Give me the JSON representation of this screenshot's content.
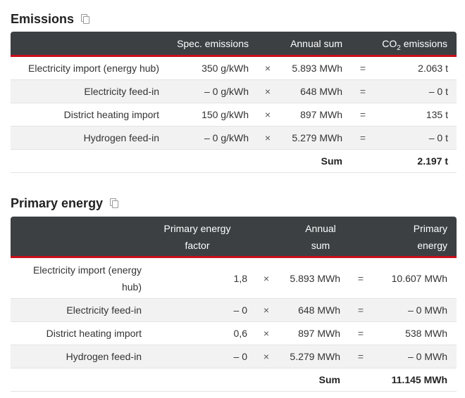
{
  "emissions": {
    "title": "Emissions",
    "headers": {
      "spec": "Spec. emissions",
      "annual": "Annual sum",
      "co2_pre": "CO",
      "co2_sub": "2",
      "co2_post": " emissions"
    },
    "rows": [
      {
        "label": "Electricity import (energy hub)",
        "factor": "350 g/kWh",
        "mult": "×",
        "annual": "5.893 MWh",
        "eq": "=",
        "result": "2.063 t"
      },
      {
        "label": "Electricity feed-in",
        "factor": "– 0 g/kWh",
        "mult": "×",
        "annual": "648 MWh",
        "eq": "=",
        "result": "– 0 t"
      },
      {
        "label": "District heating import",
        "factor": "150 g/kWh",
        "mult": "×",
        "annual": "897 MWh",
        "eq": "=",
        "result": "135 t"
      },
      {
        "label": "Hydrogen feed-in",
        "factor": "– 0 g/kWh",
        "mult": "×",
        "annual": "5.279 MWh",
        "eq": "=",
        "result": "– 0 t"
      }
    ],
    "sum_label": "Sum",
    "sum_value": "2.197 t"
  },
  "primary": {
    "title": "Primary energy",
    "headers": {
      "factor_l1": "Primary energy",
      "factor_l2": "factor",
      "annual_l1": "Annual",
      "annual_l2": "sum",
      "energy_l1": "Primary",
      "energy_l2": "energy"
    },
    "rows": [
      {
        "label": "Electricity import (energy hub)",
        "factor": "1,8",
        "mult": "×",
        "annual": "5.893 MWh",
        "eq": "=",
        "result": "10.607 MWh"
      },
      {
        "label": "Electricity feed-in",
        "factor": "– 0",
        "mult": "×",
        "annual": "648 MWh",
        "eq": "=",
        "result": "– 0 MWh"
      },
      {
        "label": "District heating import",
        "factor": "0,6",
        "mult": "×",
        "annual": "897 MWh",
        "eq": "=",
        "result": "538 MWh"
      },
      {
        "label": "Hydrogen feed-in",
        "factor": "– 0",
        "mult": "×",
        "annual": "5.279 MWh",
        "eq": "=",
        "result": "– 0 MWh"
      }
    ],
    "sum_label": "Sum",
    "sum_value": "11.145 MWh"
  },
  "icons": {
    "copy": "copy-icon"
  }
}
